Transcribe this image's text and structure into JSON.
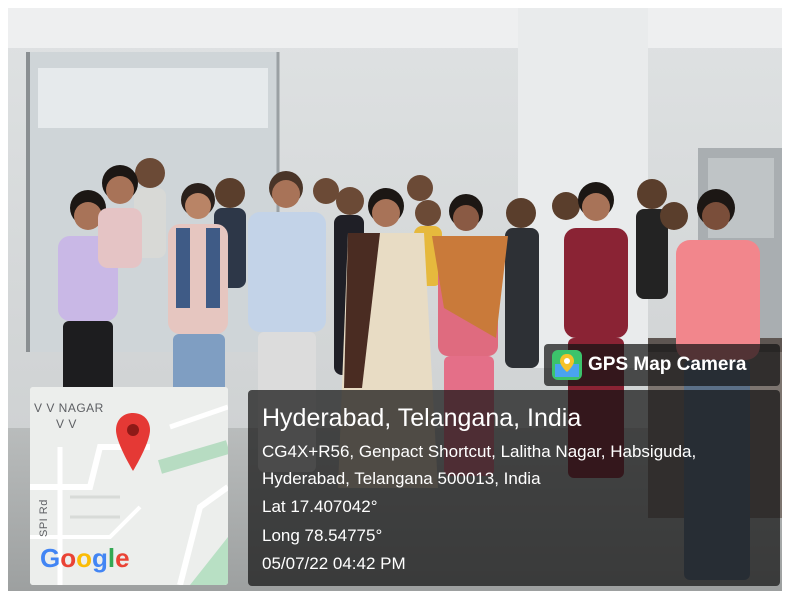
{
  "badge": {
    "label": "GPS Map Camera",
    "icon": "gps-map-camera-app-icon"
  },
  "map": {
    "area_label": "V V NAGAR",
    "area_sublabel": "V V",
    "road_label": "SPI Rd",
    "provider": [
      "G",
      "o",
      "o",
      "g",
      "l",
      "e"
    ],
    "provider_colors": [
      "#4285F4",
      "#EA4335",
      "#FBBC05",
      "#4285F4",
      "#34A853",
      "#EA4335"
    ],
    "pin_color": "#E53935"
  },
  "location": {
    "title": "Hyderabad, Telangana, India",
    "address_line1": "CG4X+R56, Genpact Shortcut, Lalitha Nagar, Habsiguda,",
    "address_line2": "Hyderabad, Telangana 500013, India",
    "lat": "Lat 17.407042°",
    "long": "Long 78.54775°",
    "datetime": "05/07/22 04:42 PM"
  }
}
